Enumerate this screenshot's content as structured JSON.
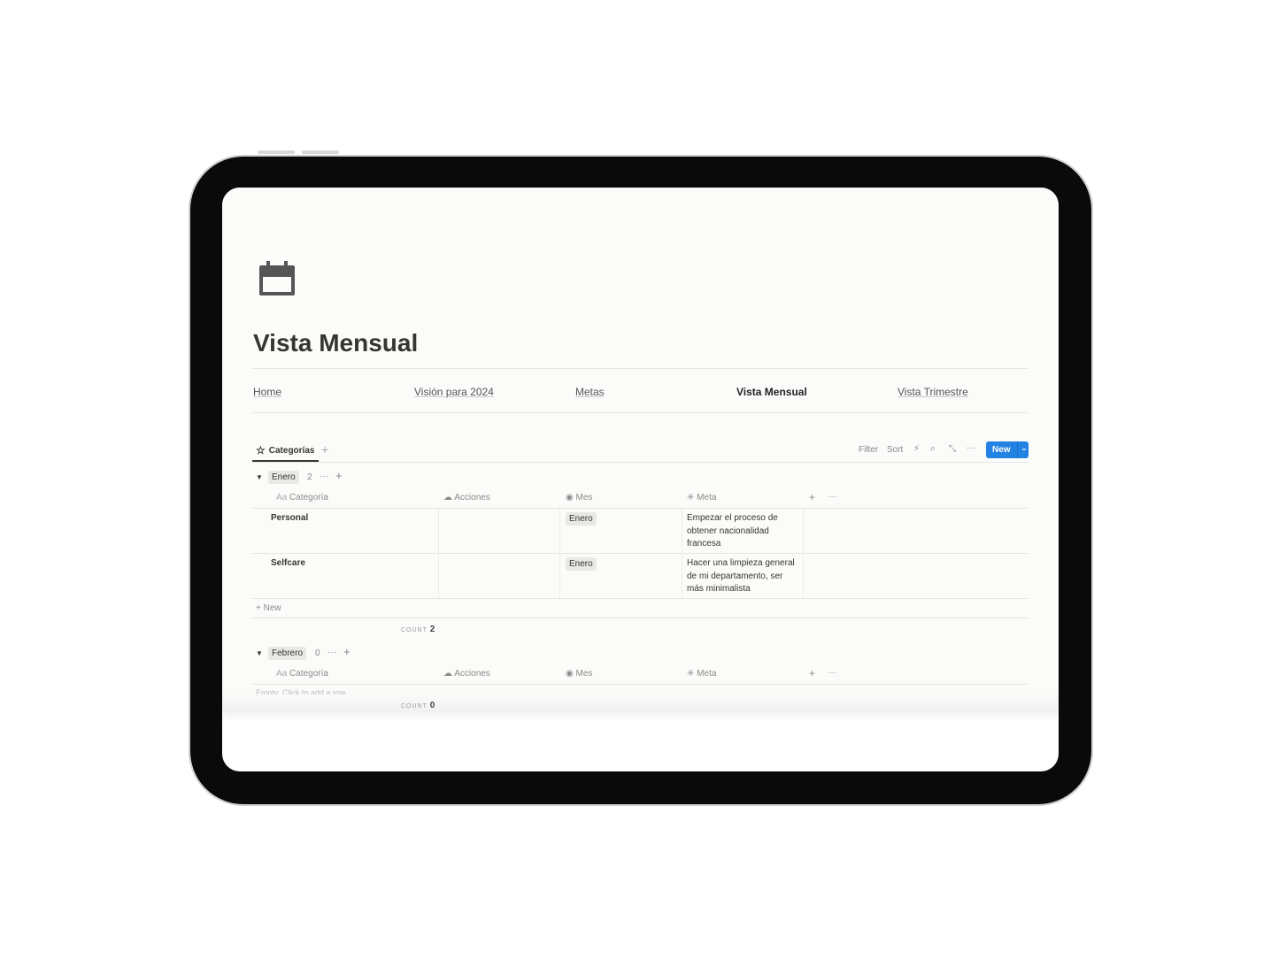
{
  "page": {
    "icon": "calendar-icon",
    "title": "Vista Mensual"
  },
  "nav": [
    "Home",
    "Visión para 2024",
    "Metas",
    "Vista Mensual",
    "Vista Trimestre"
  ],
  "nav_active": "Vista Mensual",
  "db": {
    "view_tab": "Categorías",
    "view_icon": "star-icon",
    "toolbar": {
      "filter": "Filter",
      "sort": "Sort",
      "new": "New"
    },
    "accent": "#2383e2",
    "columns": [
      "Categoría",
      "Acciones",
      "Mes",
      "Meta"
    ],
    "column_prefix": "Aa",
    "groups": [
      {
        "name": "Enero",
        "count": "2",
        "rows": [
          {
            "categoria": "Personal",
            "acciones": "",
            "mes": "Enero",
            "meta": "Empezar el proceso de obtener nacionalidad francesa"
          },
          {
            "categoria": "Selfcare",
            "acciones": "",
            "mes": "Enero",
            "meta": "Hacer una limpieza general de mi departamento, ser más minimalista"
          }
        ],
        "new_label": "New",
        "count_label": "COUNT",
        "count_value": "2"
      },
      {
        "name": "Febrero",
        "count": "0",
        "rows": [],
        "empty_label": "Empty. Click to add a row.",
        "count_label": "COUNT",
        "count_value": "0"
      }
    ]
  }
}
